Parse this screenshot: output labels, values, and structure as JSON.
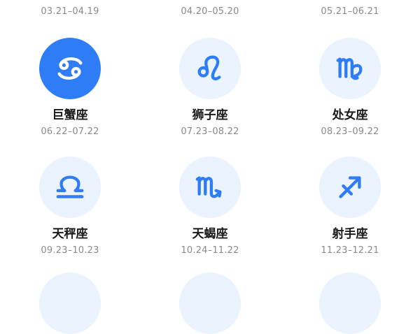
{
  "top_row_dates": [
    "03.21–04.19",
    "04.20–05.20",
    "05.21–06.21"
  ],
  "signs": [
    {
      "name": "巨蟹座",
      "dates": "06.22–07.22",
      "icon": "cancer-icon",
      "selected": true
    },
    {
      "name": "狮子座",
      "dates": "07.23–08.22",
      "icon": "leo-icon"
    },
    {
      "name": "处女座",
      "dates": "08.23–09.22",
      "icon": "virgo-icon"
    },
    {
      "name": "天秤座",
      "dates": "09.23–10.23",
      "icon": "libra-icon"
    },
    {
      "name": "天蝎座",
      "dates": "10.24–11.22",
      "icon": "scorpio-icon"
    },
    {
      "name": "射手座",
      "dates": "11.23–12.21",
      "icon": "sagittarius-icon"
    }
  ],
  "colors": {
    "accent": "#2f7df6",
    "icon_bg": "#eaf3fe",
    "text": "#1a1a1a",
    "subtext": "#8a8a8a"
  }
}
